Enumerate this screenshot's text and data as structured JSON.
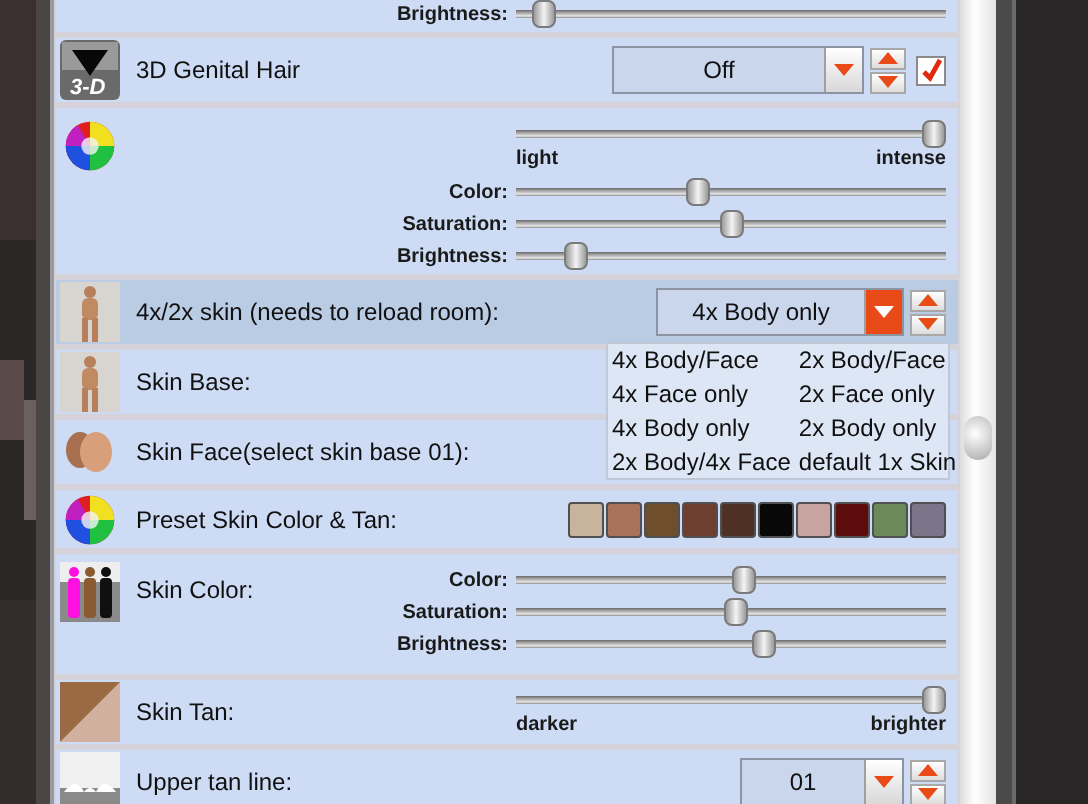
{
  "rows": [
    {
      "kind": "sliders",
      "selected": false,
      "sliders": [
        {
          "label": "Brightness:",
          "level": 0.04
        }
      ]
    },
    {
      "kind": "toggle",
      "icon_text": "3-D",
      "label": "3D Genital Hair",
      "value": "Off",
      "open": false,
      "checked": true,
      "selected": false
    },
    {
      "kind": "sliders",
      "selected": false,
      "range": {
        "level": 1,
        "min_label": "light",
        "max_label": "intense"
      },
      "sliders": [
        {
          "label": "Color:",
          "level": 0.42
        },
        {
          "label": "Saturation:",
          "level": 0.5
        },
        {
          "label": "Brightness:",
          "level": 0.12
        }
      ]
    },
    {
      "kind": "dropdown",
      "label": "4x/2x skin (needs to reload room):",
      "value": "4x Body only",
      "open": true,
      "selected": true,
      "menu": [
        "4x Body/Face",
        "2x Body/Face",
        "4x Face only",
        "2x Face only",
        "4x Body only",
        "2x Body only",
        "2x Body/4x Face",
        "default 1x Skin"
      ]
    },
    {
      "kind": "covered",
      "label": "Skin Base:",
      "selected": false
    },
    {
      "kind": "covered",
      "label": "Skin Face(select skin base 01):",
      "selected": false
    },
    {
      "kind": "swatches",
      "label": "Preset Skin Color & Tan:",
      "selected": false,
      "swatches": [
        {
          "color": "#c8b49c"
        },
        {
          "color": "#a8735a"
        },
        {
          "color": "#6e4e2c"
        },
        {
          "color": "#6e3e2e"
        },
        {
          "color": "#4e3024"
        },
        {
          "color": "#080808"
        },
        {
          "color": "#c8a4a0"
        },
        {
          "color": "#5c0c0c"
        },
        {
          "color": "#6a8a5a"
        },
        {
          "color": "#7c7488"
        }
      ]
    },
    {
      "kind": "sliders",
      "label": "Skin Color:",
      "selected": false,
      "sliders": [
        {
          "label": "Color:",
          "level": 0.53
        },
        {
          "label": "Saturation:",
          "level": 0.51
        },
        {
          "label": "Brightness:",
          "level": 0.58
        }
      ]
    },
    {
      "kind": "range",
      "label": "Skin Tan:",
      "selected": false,
      "range": {
        "level": 1,
        "min_label": "darker",
        "max_label": "brighter"
      }
    },
    {
      "kind": "dropdown",
      "label": "Upper tan line:",
      "value": "01",
      "open": false,
      "selected": false
    }
  ]
}
